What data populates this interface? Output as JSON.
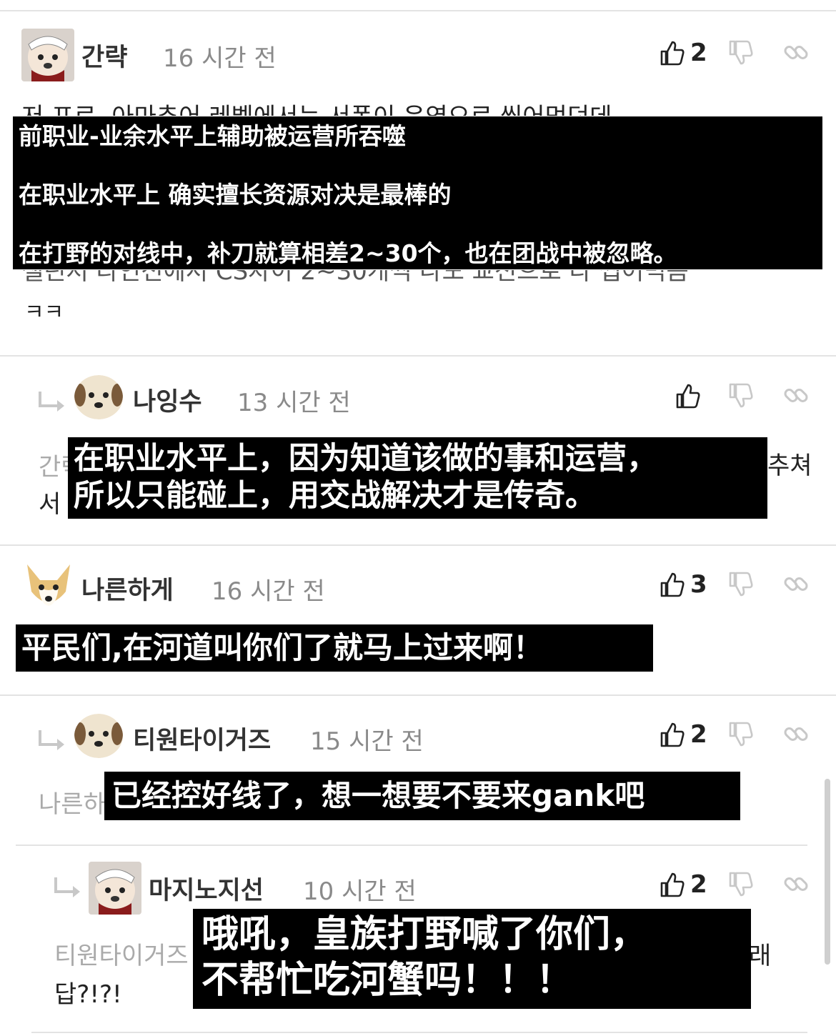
{
  "comments": [
    {
      "username": "간략",
      "time": "16 시간 전",
      "likes": "2",
      "body_top": "저 프로, 아마추어 레벨에서는 서폿이 운영으로 씹어먹던데",
      "body_bottom": "챌린저 라인전에서 CS차이 2~30개씩 나도 교전으로 다 씹어먹음",
      "body_end": "ㅋㅋ",
      "caption": [
        "前职业-业余水平上辅助被运营所吞噬",
        "在职业水平上 确实擅长资源对决是最棒的",
        "在打野的对线中，补刀就算相差2~30个，也在团战中被忽略。"
      ]
    },
    {
      "username": "나잉수",
      "time": "13 시간 전",
      "likes": "",
      "body_left1": "간략",
      "body_right1": "추쳐",
      "body_left2": "서",
      "caption": [
        "在职业水平上，因为知道该做的事和运营，",
        "所以只能碰上，用交战解决才是传奇。"
      ]
    },
    {
      "username": "나른하게",
      "time": "16 시간 전",
      "likes": "3",
      "caption": [
        "平民们,在河道叫你们了就马上过来啊！"
      ]
    },
    {
      "username": "티원타이거즈",
      "time": "15 시간 전",
      "likes": "2",
      "body_left1": "나른하",
      "caption": [
        "已经控好线了，想一想要不要来gank吧"
      ]
    },
    {
      "username": "마지노지선",
      "time": "10 시간 전",
      "likes": "2",
      "body_left1": "티원타이거즈",
      "body_right1": "래",
      "body_left2": "답?!?!",
      "caption": [
        "哦吼，皇族打野喊了你们，",
        "不帮忙吃河蟹吗！！！"
      ]
    }
  ],
  "icons": {
    "like": "thumbs-up-icon",
    "dislike": "thumbs-down-icon",
    "link": "link-icon",
    "reply": "reply-arrow-icon"
  }
}
